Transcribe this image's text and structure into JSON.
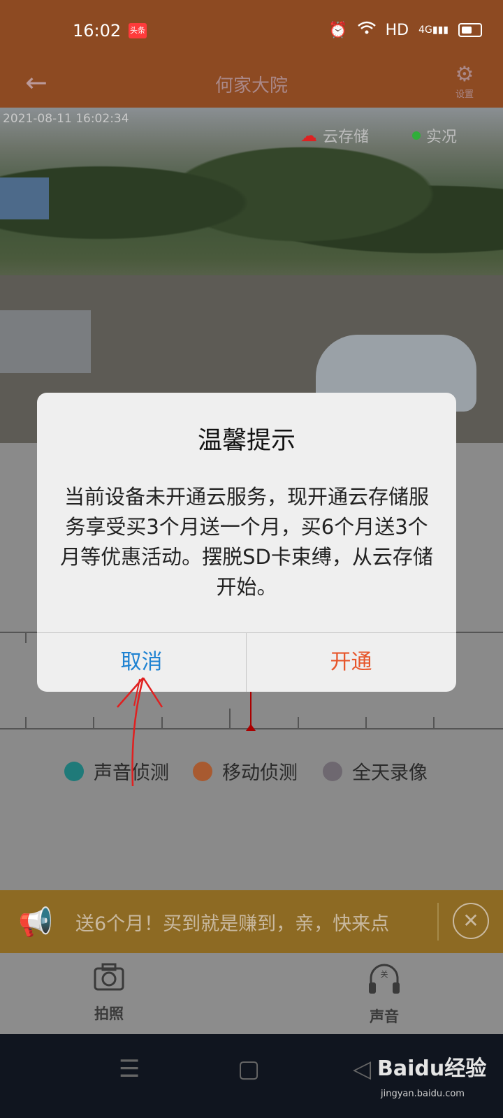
{
  "status_bar": {
    "time": "16:02",
    "app_badge": "头条",
    "network": "HD",
    "signal": "4G"
  },
  "header": {
    "title": "何家大院",
    "settings_label": "设置"
  },
  "video": {
    "timestamp": "2021-08-11 16:02:34",
    "cloud_label": "云存储",
    "live_label": "实况"
  },
  "legend": [
    {
      "label": "声音侦测",
      "color": "#1f7a79"
    },
    {
      "label": "移动侦测",
      "color": "#a85a30"
    },
    {
      "label": "全天录像",
      "color": "#6e6870"
    }
  ],
  "promo": {
    "text": "送6个月！买到就是赚到，亲，快来点"
  },
  "toolbar": {
    "photo_label": "拍照",
    "sound_label": "声音",
    "sound_state": "关"
  },
  "dialog": {
    "title": "温馨提示",
    "message": "当前设备未开通云服务，现开通云存储服务享受买3个月送一个月，买6个月送3个月等优惠活动。摆脱SD卡束缚，从云存储开始。",
    "cancel_label": "取消",
    "confirm_label": "开通"
  },
  "watermark": {
    "brand": "Baidu经验",
    "url": "jingyan.baidu.com"
  }
}
